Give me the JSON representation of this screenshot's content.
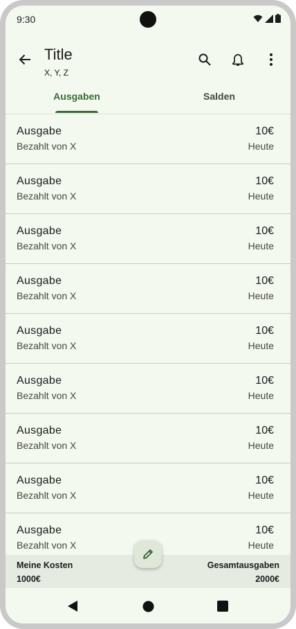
{
  "status_bar": {
    "time": "9:30",
    "icons": [
      "wifi-icon",
      "signal-icon",
      "battery-icon"
    ]
  },
  "app_bar": {
    "title": "Title",
    "subtitle": "X, Y, Z",
    "icons": [
      "back-arrow-icon",
      "search-icon",
      "bell-icon",
      "more-vert-icon"
    ]
  },
  "tabs": [
    {
      "label": "Ausgaben",
      "selected": true
    },
    {
      "label": "Salden",
      "selected": false
    }
  ],
  "expenses": [
    {
      "title": "Ausgabe",
      "paid_by": "Bezahlt von X",
      "amount": "10€",
      "date": "Heute"
    },
    {
      "title": "Ausgabe",
      "paid_by": "Bezahlt von X",
      "amount": "10€",
      "date": "Heute"
    },
    {
      "title": "Ausgabe",
      "paid_by": "Bezahlt von X",
      "amount": "10€",
      "date": "Heute"
    },
    {
      "title": "Ausgabe",
      "paid_by": "Bezahlt von X",
      "amount": "10€",
      "date": "Heute"
    },
    {
      "title": "Ausgabe",
      "paid_by": "Bezahlt von X",
      "amount": "10€",
      "date": "Heute"
    },
    {
      "title": "Ausgabe",
      "paid_by": "Bezahlt von X",
      "amount": "10€",
      "date": "Heute"
    },
    {
      "title": "Ausgabe",
      "paid_by": "Bezahlt von X",
      "amount": "10€",
      "date": "Heute"
    },
    {
      "title": "Ausgabe",
      "paid_by": "Bezahlt von X",
      "amount": "10€",
      "date": "Heute"
    },
    {
      "title": "Ausgabe",
      "paid_by": "Bezahlt von X",
      "amount": "10€",
      "date": "Heute"
    }
  ],
  "summary": {
    "my_costs_label": "Meine Kosten",
    "my_costs_value": "1000€",
    "total_label": "Gesamtausgaben",
    "total_value": "2000€"
  },
  "fab": {
    "icon": "pencil-icon"
  },
  "colors": {
    "accent": "#3a6b35",
    "background": "#f3f9ef",
    "summary_background": "#e6ebe2"
  }
}
